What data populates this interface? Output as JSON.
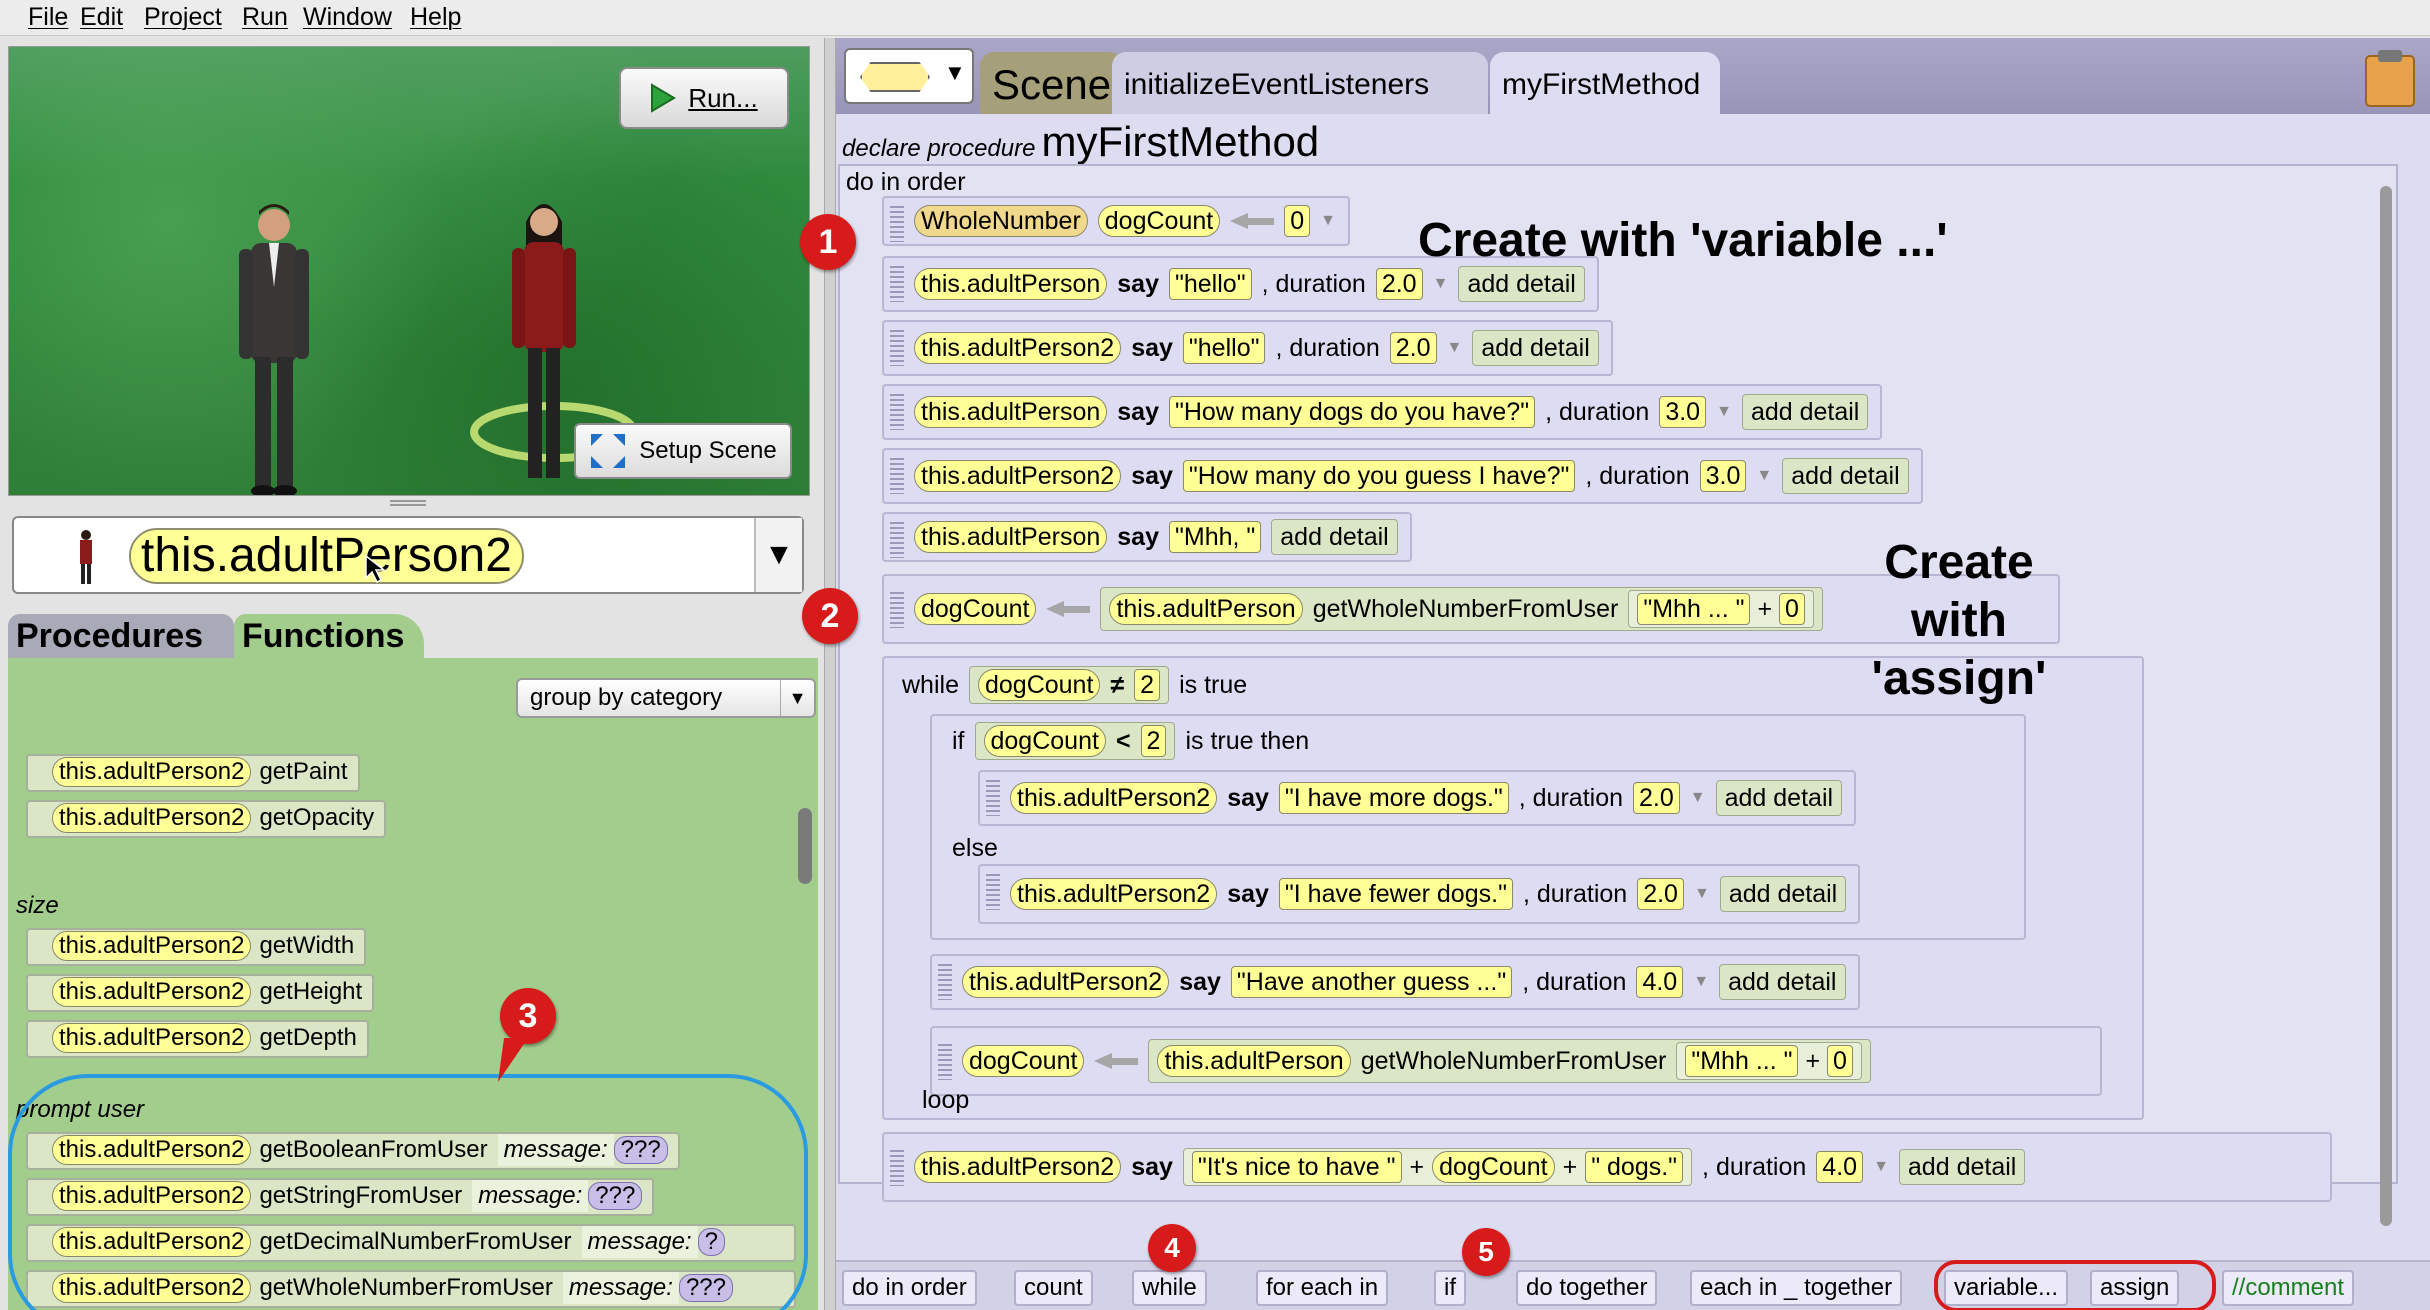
{
  "menu": {
    "file": "File",
    "edit": "Edit",
    "project": "Project",
    "run": "Run",
    "window": "Window",
    "help": "Help"
  },
  "scene": {
    "run": "Run...",
    "setup": "Setup Scene"
  },
  "selected_object": "this.adultPerson2",
  "left_tabs": {
    "procedures": "Procedures",
    "functions": "Functions"
  },
  "group_by": "group by category",
  "palette": {
    "object": "this.adultPerson2",
    "paint": "getPaint",
    "opacity": "getOpacity",
    "cat_size": "size",
    "width": "getWidth",
    "height": "getHeight",
    "depth": "getDepth",
    "cat_prompt": "prompt user",
    "bool": "getBooleanFromUser",
    "string": "getStringFromUser",
    "decimal": "getDecimalNumberFromUser",
    "whole": "getWholeNumberFromUser",
    "message": "message:",
    "qqq": "???",
    "partial_q": "?"
  },
  "tabs": {
    "scene": "Scene",
    "init": "initializeEventListeners",
    "method": "myFirstMethod"
  },
  "decl": {
    "prefix": "declare procedure",
    "name": "myFirstMethod"
  },
  "code": {
    "do_in_order": "do in order",
    "type": "WholeNumber",
    "var": "dogCount",
    "zero": "0",
    "p1": "this.adultPerson",
    "p2": "this.adultPerson2",
    "say": "say",
    "duration": ", duration",
    "add_detail": "add detail",
    "hello": "\"hello\"",
    "dur2": "2.0",
    "dur3": "3.0",
    "dur4": "4.0",
    "how_many": "\"How many dogs do you have?\"",
    "guess": "\"How many do you guess I have?\"",
    "mhh": "\"Mhh, \"",
    "getwhole": "getWholeNumberFromUser",
    "mhhdots": "\"Mhh ... \"",
    "plus": "+",
    "while": "while",
    "neq": "≠",
    "two": "2",
    "is_true": "is true",
    "if": "if",
    "lt": "<",
    "is_true_then": "is true then",
    "more": "\"I have more dogs.\"",
    "else": "else",
    "fewer": "\"I have fewer dogs.\"",
    "another": "\"Have another guess ...\"",
    "loop": "loop",
    "nice": "\"It's nice to have \"",
    "dogs": "\" dogs.\""
  },
  "annotations": {
    "variable": "Create with 'variable ...'",
    "assign_l1": "Create with",
    "assign_l2": "'assign'",
    "b1": "1",
    "b2": "2",
    "b3": "3",
    "b4": "4",
    "b5": "5"
  },
  "bottom": {
    "do_in_order": "do in order",
    "count": "count",
    "while": "while",
    "for_each": "for each in",
    "if": "if",
    "do_together": "do together",
    "each_together": "each in _ together",
    "variable": "variable...",
    "assign": "assign",
    "comment": "//comment"
  },
  "colors": {
    "object_pill": "#ffff96",
    "code_bg": "#dedcf2",
    "palette_bg": "#a3cd8d",
    "badge": "#d71a1a",
    "highlight_ring": "#2a9be0"
  }
}
